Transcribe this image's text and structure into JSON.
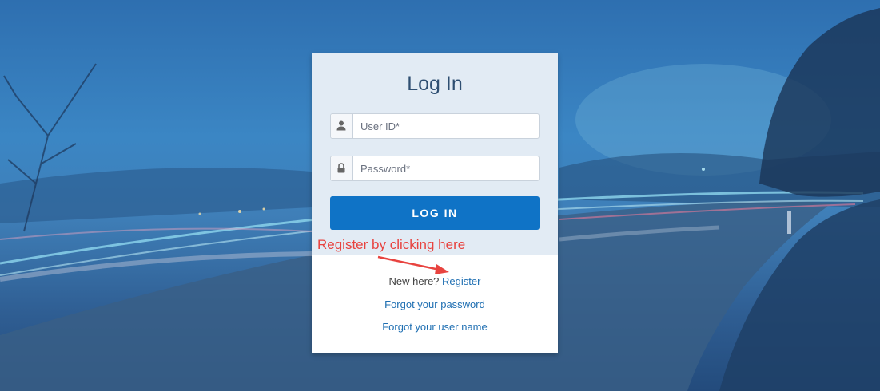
{
  "login": {
    "title": "Log In",
    "user_id_placeholder": "User ID*",
    "password_placeholder": "Password*",
    "login_button": "LOG IN"
  },
  "annotation": {
    "text": "Register by clicking here",
    "color": "#e8433f"
  },
  "links": {
    "new_here": "New here?",
    "register": "Register",
    "forgot_password": "Forgot your password",
    "forgot_username": "Forgot your user name"
  },
  "colors": {
    "accent": "#0f73c6",
    "link": "#1f6fb2",
    "title": "#2f4f72"
  },
  "icons": {
    "user_field": "user-icon",
    "password_field": "lock-icon",
    "annotation_arrow": "arrow-icon"
  }
}
